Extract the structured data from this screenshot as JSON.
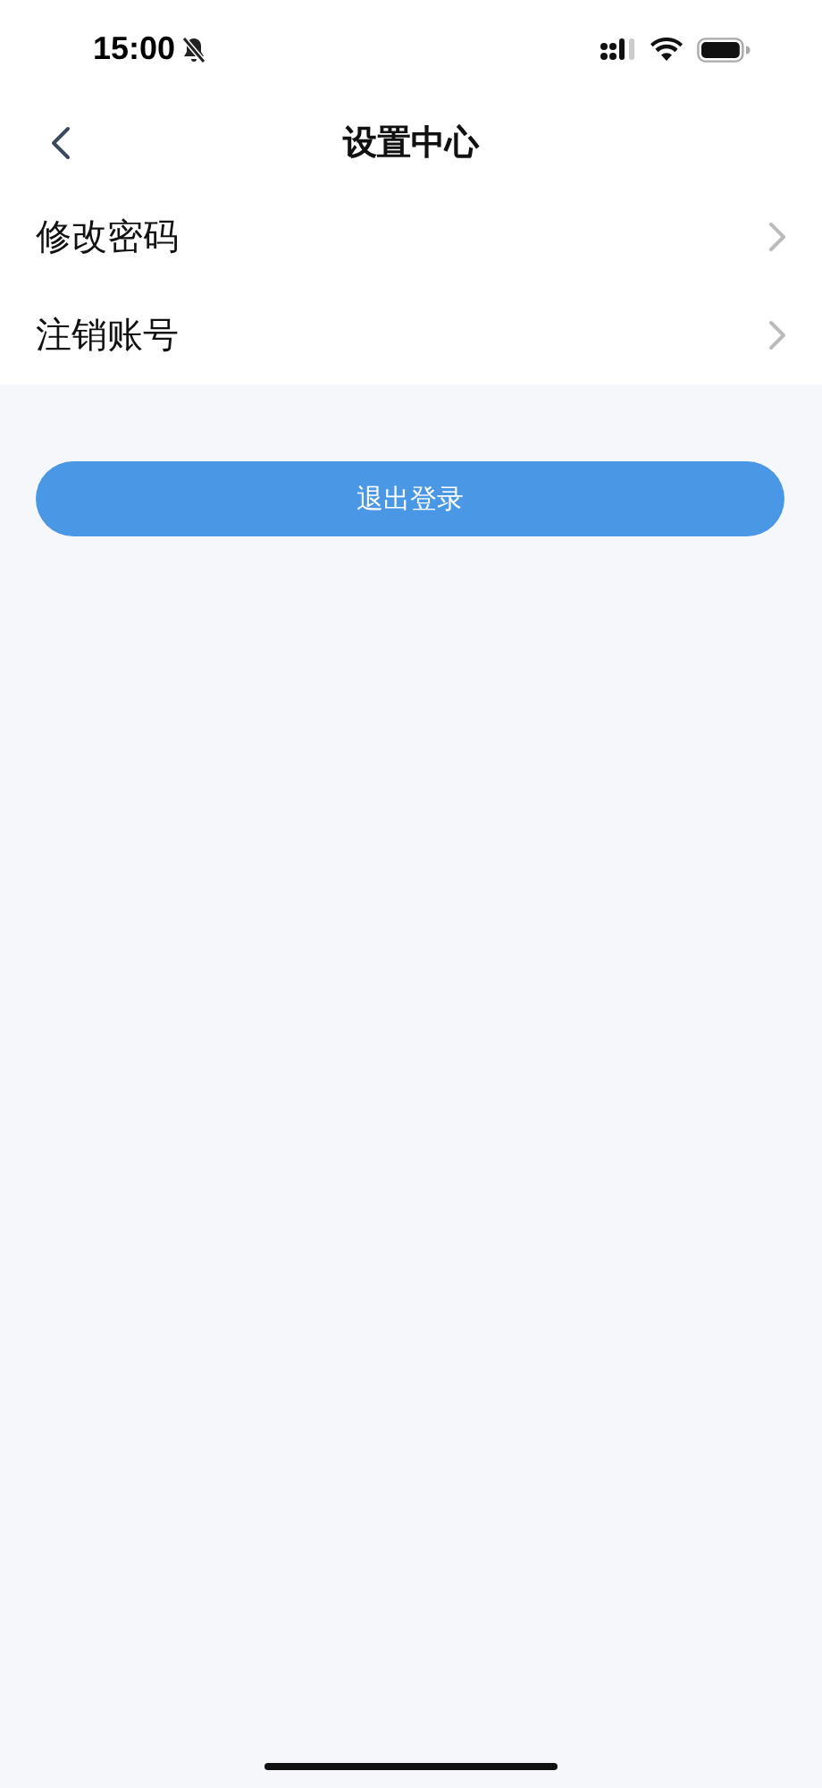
{
  "status_bar": {
    "time": "15:00",
    "muted": true
  },
  "nav": {
    "title": "设置中心"
  },
  "items": [
    {
      "label": "修改密码"
    },
    {
      "label": "注销账号"
    }
  ],
  "logout_button": {
    "label": "退出登录"
  }
}
